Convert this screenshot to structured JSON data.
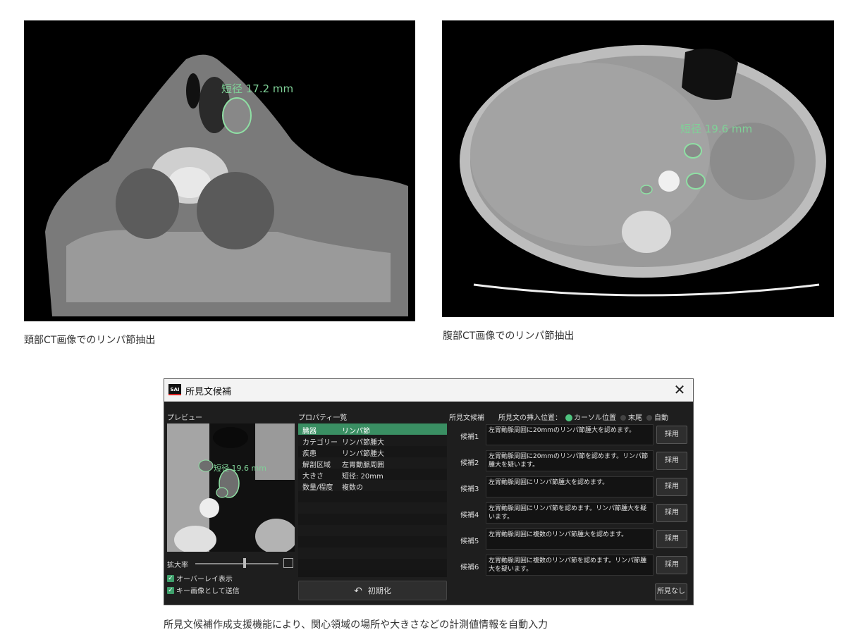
{
  "ct_neck": {
    "measure_label": "短径 17.2 mm",
    "caption": "頸部CT画像でのリンパ節抽出"
  },
  "ct_abdomen": {
    "measure_label": "短径 19.6 mm",
    "caption": "腹部CT画像でのリンパ節抽出"
  },
  "dialog": {
    "app_logo": "SAI",
    "title": "所見文候補",
    "close": "✕",
    "preview": {
      "label": "プレビュー",
      "measure_label": "短径 19.6 mm",
      "zoom_label": "拡大率",
      "zoom_fraction": 0.6,
      "overlay_label": "オーバーレイ表示",
      "send_key_label": "キー画像として送信"
    },
    "properties": {
      "label": "プロパティ一覧",
      "rows": [
        {
          "key": "臓器",
          "value": "リンパ節"
        },
        {
          "key": "カテゴリー",
          "value": "リンパ節腫大"
        },
        {
          "key": "疾患",
          "value": "リンパ節腫大"
        },
        {
          "key": "解剖区域",
          "value": "左胃動脈周囲"
        },
        {
          "key": "大きさ",
          "value": "短径: 20mm"
        },
        {
          "key": "数量/程度",
          "value": "複数の"
        }
      ],
      "reset_icon": "ALL",
      "reset_label": "初期化"
    },
    "findings": {
      "label": "所見文候補",
      "insert_label": "所見文の挿入位置：",
      "options": [
        "カーソル位置",
        "末尾",
        "自動"
      ],
      "selected": "カーソル位置",
      "candidates": [
        {
          "label": "候補1",
          "text": "左胃動脈周囲に20mmのリンパ節腫大を認めます。"
        },
        {
          "label": "候補2",
          "text": "左胃動脈周囲に20mmのリンパ節を認めます。リンパ節腫大を疑います。"
        },
        {
          "label": "候補3",
          "text": "左胃動脈周囲にリンパ節腫大を認めます。"
        },
        {
          "label": "候補4",
          "text": "左胃動脈周囲にリンパ節を認めます。リンパ節腫大を疑います。"
        },
        {
          "label": "候補5",
          "text": "左胃動脈周囲に複数のリンパ節腫大を認めます。"
        },
        {
          "label": "候補6",
          "text": "左胃動脈周囲に複数のリンパ節を認めます。リンパ節腫大を疑います。"
        }
      ],
      "adopt_label": "採用",
      "no_finding_label": "所見なし"
    }
  },
  "bottom_caption": "所見文候補作成支援機能により、関心領域の場所や大きさなどの計測値情報を自動入力"
}
